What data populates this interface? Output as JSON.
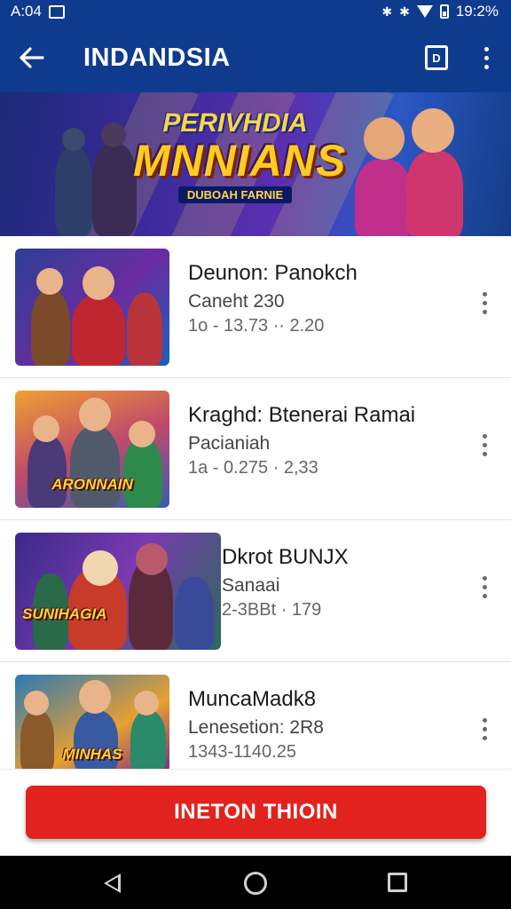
{
  "status_bar": {
    "time": "A:04",
    "battery_text": "19:2%"
  },
  "app_bar": {
    "title": "INDANDSIA",
    "badge_label": "D"
  },
  "banner": {
    "topline": "PERIVHDIA",
    "mainline": "MNNIANS",
    "subline": "DUBOAH FARNIE"
  },
  "items": [
    {
      "title": "Deunon: Panokch",
      "subtitle": "Caneht 230",
      "meta": "1o - 13.73 ·· 2.20",
      "thumb_label": ""
    },
    {
      "title": "Kraghd: Btenerai Ramai",
      "subtitle": "Pacianiah",
      "meta": "1a - 0.275 · 2,33",
      "thumb_label": "ARONNAIN"
    },
    {
      "title": "Dkrot BUNJX",
      "subtitle": "Sanaai",
      "meta": "2-3BBt · 179",
      "thumb_label": "SUNIHAGIA"
    },
    {
      "title": "MuncaMadk8",
      "subtitle": "Lenesetion: 2R8",
      "meta": "1343-1140.25",
      "thumb_label": "MINHAS"
    }
  ],
  "cta": {
    "label": "INETON THIOIN"
  },
  "colors": {
    "appbar": "#0f3b8f",
    "cta": "#e1221f"
  },
  "icons": [
    "back-arrow-icon",
    "badge-icon",
    "overflow-menu-icon",
    "nav-back-icon",
    "nav-home-icon",
    "nav-recents-icon"
  ]
}
